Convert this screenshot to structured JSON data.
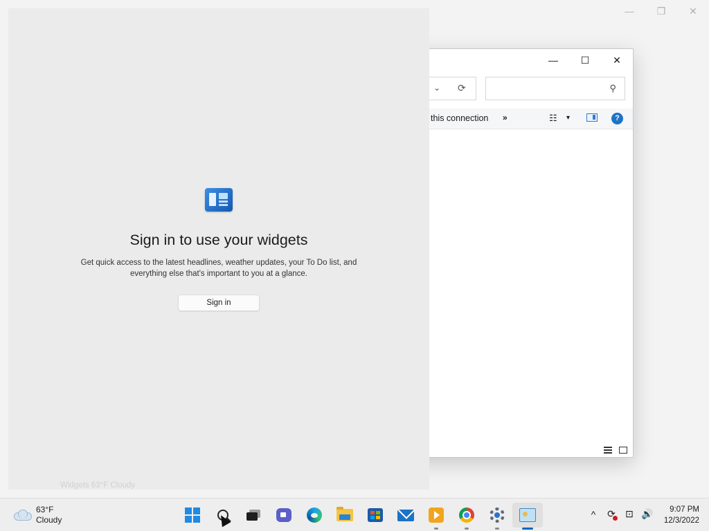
{
  "background_window": {
    "controls": {
      "minimize": "—",
      "restore": "❐",
      "close": "✕"
    }
  },
  "explorer": {
    "controls": {
      "minimize": "—",
      "maximize": "☐",
      "close": "✕"
    },
    "address": {
      "chevron": "⌄",
      "refresh": "⟳"
    },
    "search": {
      "placeholder": "",
      "icon": "⚲"
    },
    "command_bar": {
      "connection_label": "this connection",
      "more": "»",
      "view_icon": "☷",
      "view_dropdown": "▾",
      "help": "?"
    }
  },
  "widgets": {
    "title": "Sign in to use your widgets",
    "description": "Get quick access to the latest headlines, weather updates, your To Do list, and everything else that's important to you at a glance.",
    "sign_in_button": "Sign in",
    "tooltip": "Widgets 63°F Cloudy"
  },
  "taskbar": {
    "weather": {
      "temp": "63°F",
      "condition": "Cloudy"
    },
    "pinned": [
      "start",
      "search",
      "task-view",
      "chat",
      "edge",
      "file-explorer",
      "microsoft-store",
      "mail",
      "media-player",
      "chrome",
      "settings",
      "control-panel"
    ],
    "tray": {
      "chevron": "^",
      "sync": "⟳",
      "network": "⊡",
      "volume": "🔊"
    },
    "clock": {
      "time": "9:07 PM",
      "date": "12/3/2022"
    }
  }
}
